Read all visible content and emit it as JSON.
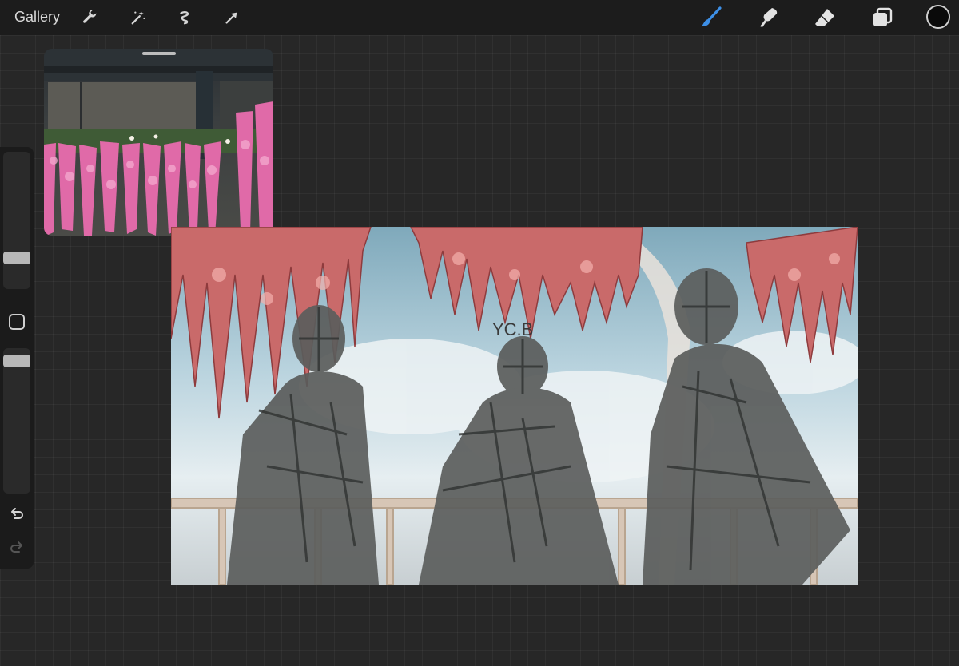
{
  "toolbar": {
    "gallery_label": "Gallery",
    "left_tools": [
      "wrench-icon",
      "magic-wand-icon",
      "selection-icon",
      "transform-arrow-icon"
    ],
    "right_tools": [
      "brush-icon",
      "smudge-icon",
      "eraser-icon",
      "layers-icon"
    ],
    "active_tool": "brush-icon",
    "accent_color": "#3d8fe6",
    "current_color": "#0a0a0a"
  },
  "sidebar": {
    "brush_size_level": 0.2,
    "opacity_level": 0.95,
    "tools": [
      "modify-icon",
      "undo-icon",
      "redo-icon"
    ]
  },
  "canvas": {
    "artwork_text": "YC.B"
  },
  "reference": {
    "visible": true
  }
}
